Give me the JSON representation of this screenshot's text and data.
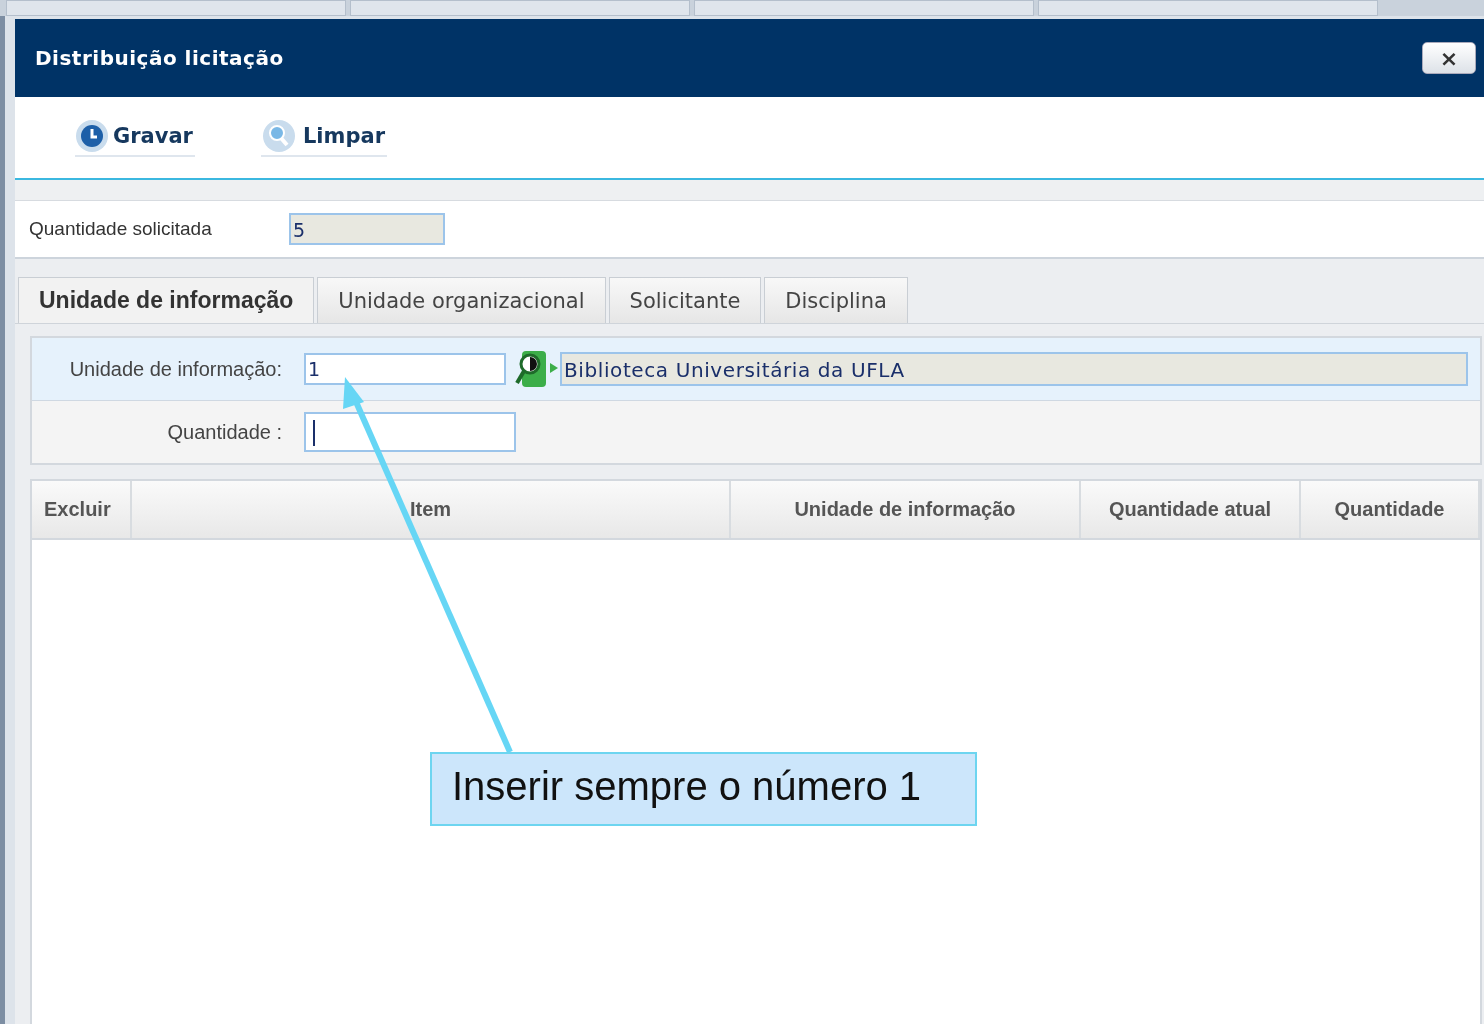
{
  "window": {
    "title": "Distribuição licitação",
    "close_label": "×"
  },
  "toolbar": [
    {
      "label": "Gravar",
      "kind": "save"
    },
    {
      "label": "Limpar",
      "kind": "clear"
    }
  ],
  "requested": {
    "label": "Quantidade solicitada",
    "value": "5"
  },
  "tabs": [
    {
      "label": "Unidade de informação",
      "selected": true
    },
    {
      "label": "Unidade organizacional",
      "selected": false
    },
    {
      "label": "Solicitante",
      "selected": false
    },
    {
      "label": "Disciplina",
      "selected": false
    }
  ],
  "form": {
    "unit_label": "Unidade de informação:",
    "unit_value": "1",
    "unit_name": "Biblioteca Universitária da UFLA",
    "quantity_label": "Quantidade :"
  },
  "table": {
    "columns": [
      "Excluir",
      "Item",
      "Unidade de informação",
      "Quantidade atual",
      "Quantidade"
    ]
  },
  "callout": {
    "text": "Inserir sempre o número 1"
  }
}
